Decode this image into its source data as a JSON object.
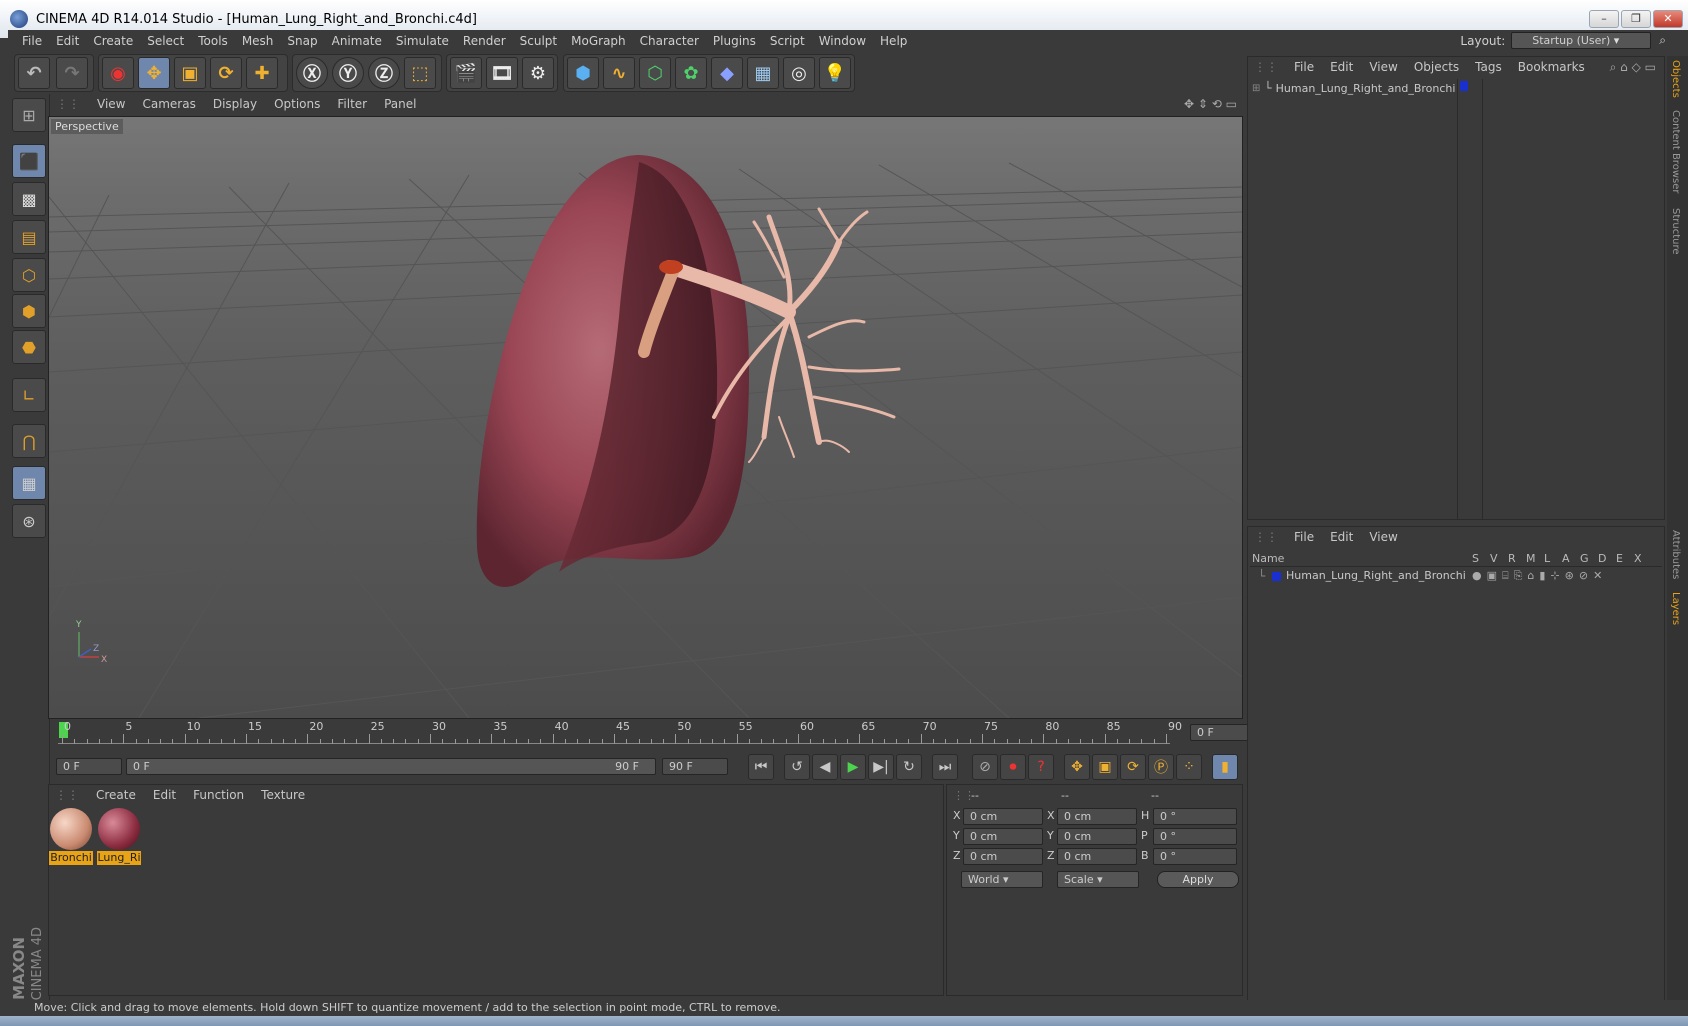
{
  "window": {
    "title": "CINEMA 4D R14.014 Studio - [Human_Lung_Right_and_Bronchi.c4d]"
  },
  "menu": [
    "File",
    "Edit",
    "Create",
    "Select",
    "Tools",
    "Mesh",
    "Snap",
    "Animate",
    "Simulate",
    "Render",
    "Sculpt",
    "MoGraph",
    "Character",
    "Plugins",
    "Script",
    "Window",
    "Help"
  ],
  "layout": {
    "label": "Layout:",
    "value": "Startup (User)"
  },
  "viewport": {
    "menu": [
      "View",
      "Cameras",
      "Display",
      "Options",
      "Filter",
      "Panel"
    ],
    "label": "Perspective",
    "axes": {
      "y": "Y",
      "z": "Z",
      "x": "X"
    }
  },
  "timeline": {
    "ticks": [
      "0",
      "5",
      "10",
      "15",
      "20",
      "25",
      "30",
      "35",
      "40",
      "45",
      "50",
      "55",
      "60",
      "65",
      "70",
      "75",
      "80",
      "85",
      "90"
    ],
    "current_frame": "0 F",
    "start_field": "0 F",
    "slider_left": "0 F",
    "slider_right": "90 F",
    "end_field": "90 F"
  },
  "materials": {
    "menu": [
      "Create",
      "Edit",
      "Function",
      "Texture"
    ],
    "items": [
      {
        "label": "Bronchi"
      },
      {
        "label": "Lung_Ri"
      }
    ]
  },
  "coordinates": {
    "col_headers": [
      "--",
      "--",
      "--"
    ],
    "rows": [
      {
        "l1": "X",
        "v1": "0 cm",
        "l2": "X",
        "v2": "0 cm",
        "l3": "H",
        "v3": "0 °"
      },
      {
        "l1": "Y",
        "v1": "0 cm",
        "l2": "Y",
        "v2": "0 cm",
        "l3": "P",
        "v3": "0 °"
      },
      {
        "l1": "Z",
        "v1": "0 cm",
        "l2": "Z",
        "v2": "0 cm",
        "l3": "B",
        "v3": "0 °"
      }
    ],
    "world": "World",
    "scale": "Scale",
    "apply": "Apply"
  },
  "objects_panel": {
    "menu": [
      "File",
      "Edit",
      "View",
      "Objects",
      "Tags",
      "Bookmarks"
    ],
    "item": "Human_Lung_Right_and_Bronchi"
  },
  "layers_panel": {
    "menu": [
      "File",
      "Edit",
      "View"
    ],
    "columns": [
      "Name",
      "S",
      "V",
      "R",
      "M",
      "L",
      "A",
      "G",
      "D",
      "E",
      "X"
    ],
    "item": "Human_Lung_Right_and_Bronchi"
  },
  "right_tabs": [
    "Objects",
    "Content Browser",
    "Structure",
    "Attributes",
    "Layers"
  ],
  "branding": {
    "line1": "MAXON",
    "line2": "CINEMA 4D"
  },
  "status": "Move: Click and drag to move elements. Hold down SHIFT to quantize movement / add to the selection in point mode, CTRL to remove.",
  "colors": {
    "accent": "#e8a317",
    "selected": "#6f87ad",
    "layer_color": "#1a2fd0"
  }
}
